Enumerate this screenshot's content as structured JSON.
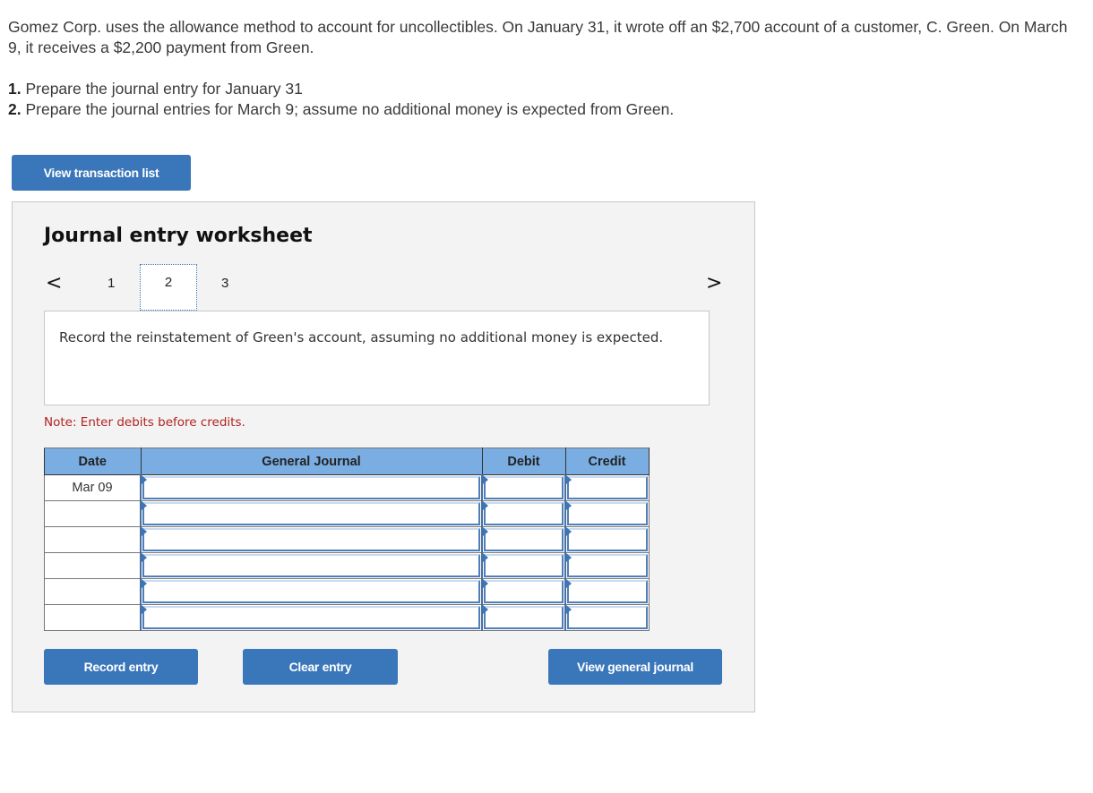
{
  "problem": {
    "text": "Gomez Corp. uses the allowance method to account for uncollectibles. On January 31, it wrote off an $2,700 account of a customer, C. Green. On March 9, it receives a $2,200 payment from Green.",
    "requirements": [
      {
        "num": "1.",
        "text": " Prepare the journal entry for January 31"
      },
      {
        "num": "2.",
        "text": " Prepare the journal entries for March 9; assume no additional money is expected from Green."
      }
    ]
  },
  "buttons": {
    "view_transaction_list": "View transaction list",
    "record_entry": "Record entry",
    "clear_entry": "Clear entry",
    "view_general_journal": "View general journal"
  },
  "worksheet": {
    "title": "Journal entry worksheet",
    "pager": {
      "prev_icon": "chevron-left-icon",
      "next_icon": "chevron-right-icon",
      "prev_glyph": "<",
      "next_glyph": ">",
      "pages": [
        "1",
        "2",
        "3"
      ],
      "current": "2"
    },
    "instruction": "Record the reinstatement of Green's account, assuming no additional money is expected.",
    "note": "Note: Enter debits before credits.",
    "table": {
      "headers": [
        "Date",
        "General Journal",
        "Debit",
        "Credit"
      ],
      "rows": [
        {
          "date": "Mar 09",
          "account": "",
          "debit": "",
          "credit": ""
        },
        {
          "date": "",
          "account": "",
          "debit": "",
          "credit": ""
        },
        {
          "date": "",
          "account": "",
          "debit": "",
          "credit": ""
        },
        {
          "date": "",
          "account": "",
          "debit": "",
          "credit": ""
        },
        {
          "date": "",
          "account": "",
          "debit": "",
          "credit": ""
        },
        {
          "date": "",
          "account": "",
          "debit": "",
          "credit": ""
        }
      ]
    }
  },
  "colors": {
    "accent": "#3a76ba",
    "header_bg": "#7aaee3",
    "note": "#b22222",
    "panel_bg": "#f3f3f3"
  }
}
